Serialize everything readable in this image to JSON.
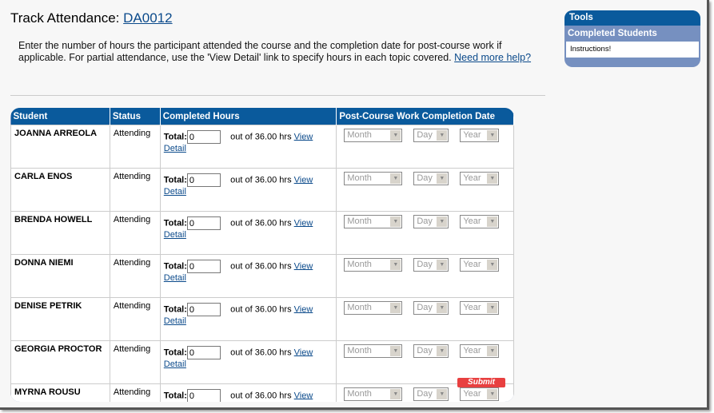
{
  "header": {
    "title_prefix": "Track Attendance:",
    "course_id": "DA0012"
  },
  "intro": {
    "text": "Enter the number of hours the participant attended the course and the completion date for post-course work if applicable. For partial attendance, use the 'View Detail' link to specify hours in each topic covered.",
    "help_link": "Need more help?"
  },
  "table": {
    "columns": [
      "Student",
      "Status",
      "Completed Hours",
      "Post-Course Work Completion Date"
    ],
    "total_label": "Total:",
    "out_of": "out of 36.00 hrs",
    "view_detail": "View Detail",
    "month_placeholder": "Month",
    "day_placeholder": "Day",
    "year_placeholder": "Year",
    "rows": [
      {
        "student": "JOANNA ARREOLA",
        "status": "Attending",
        "hours": "0"
      },
      {
        "student": "CARLA ENOS",
        "status": "Attending",
        "hours": "0"
      },
      {
        "student": "BRENDA HOWELL",
        "status": "Attending",
        "hours": "0"
      },
      {
        "student": "DONNA NIEMI",
        "status": "Attending",
        "hours": "0"
      },
      {
        "student": "DENISE PETRIK",
        "status": "Attending",
        "hours": "0"
      },
      {
        "student": "GEORGIA PROCTOR",
        "status": "Attending",
        "hours": "0"
      },
      {
        "student": "MYRNA ROUSU",
        "status": "Attending",
        "hours": "0"
      }
    ],
    "submit_label": "Submit"
  },
  "sidebar": {
    "title": "Tools",
    "section": "Completed Students",
    "item": "Instructions!"
  },
  "colors": {
    "header_blue": "#0a5a9c",
    "panel_blue": "#7690c0",
    "submit_red": "#e84040"
  }
}
